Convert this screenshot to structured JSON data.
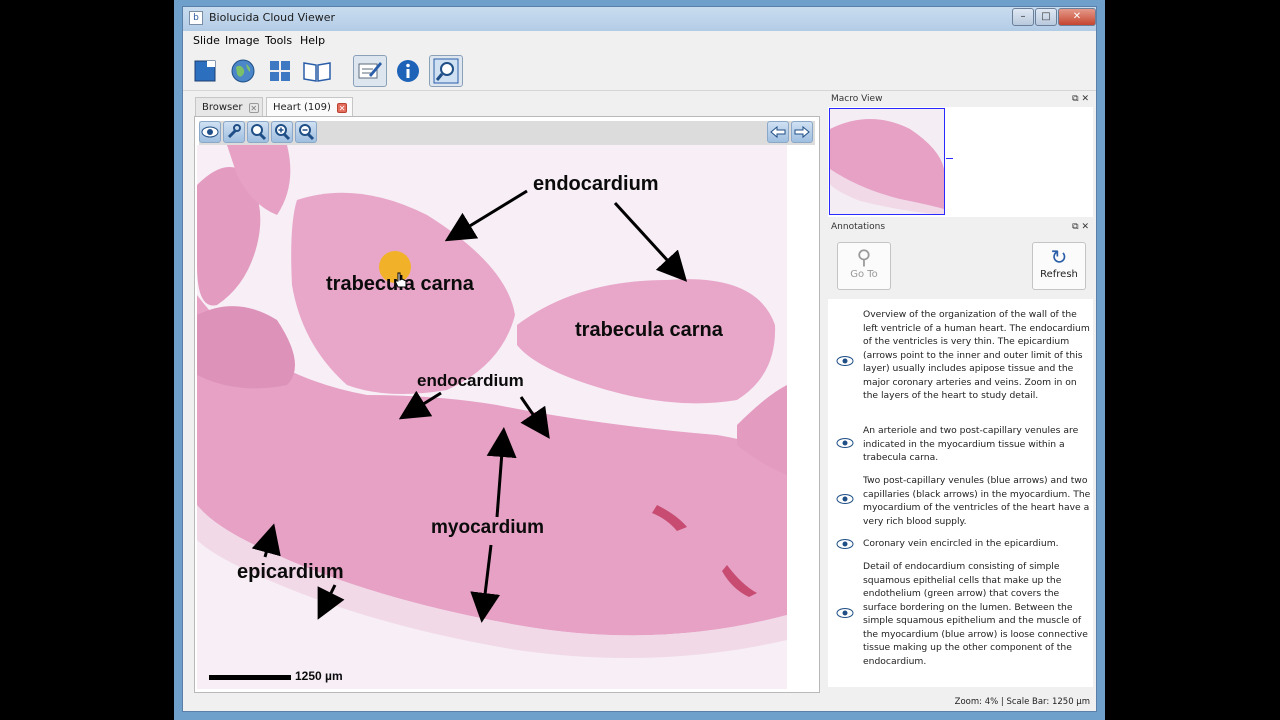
{
  "window": {
    "title": "Biolucida Cloud Viewer"
  },
  "menu": [
    "Slide",
    "Image",
    "Tools",
    "Help"
  ],
  "tabs": {
    "browser": "Browser",
    "heart": "Heart (109)"
  },
  "slide": {
    "labels": {
      "endocardium_top": "endocardium",
      "trabecula_left": "trabecula carna",
      "trabecula_right": "trabecula carna",
      "endocardium_mid": "endocardium",
      "myocardium": "myocardium",
      "epicardium": "epicardium"
    },
    "scale_bar": "1250 µm"
  },
  "macro_view": {
    "title": "Macro View"
  },
  "annotations": {
    "title": "Annotations",
    "goto_label": "Go To",
    "refresh_label": "Refresh",
    "items": [
      "Overview of the organization of the wall of the left ventricle of a human heart.  The endocardium of the ventricles is very thin.  The epicardium (arrows point to the inner and outer limit of this layer) usually includes apipose tissue and the major coronary arteries and veins. Zoom in on the layers of the heart to study detail.",
      "An arteriole and two post-capillary venules are indicated in the myocardium tissue within a trabecula carna.",
      "Two post-capillary venules (blue arrows) and two capillaries (black arrows) in the myocardium. The myocardium of the ventricles of the heart have a very rich blood supply.",
      "Coronary vein encircled in the epicardium.",
      "Detail of endocardium consisting of simple squamous epithelial cells that make up the endothelium (green arrow) that covers the surface bordering on the lumen.  Between the simple squamous epithelium and the muscle of the myocardium (blue arrow) is loose connective tissue making up the other component of the endocardium."
    ]
  },
  "status": {
    "text": "Zoom: 4% | Scale Bar: 1250 µm"
  },
  "colors": {
    "tissue": "#e9a6c8",
    "tissue_dark": "#d97aa8",
    "background": "#f7eef6",
    "accent": "#2a5ea8"
  }
}
